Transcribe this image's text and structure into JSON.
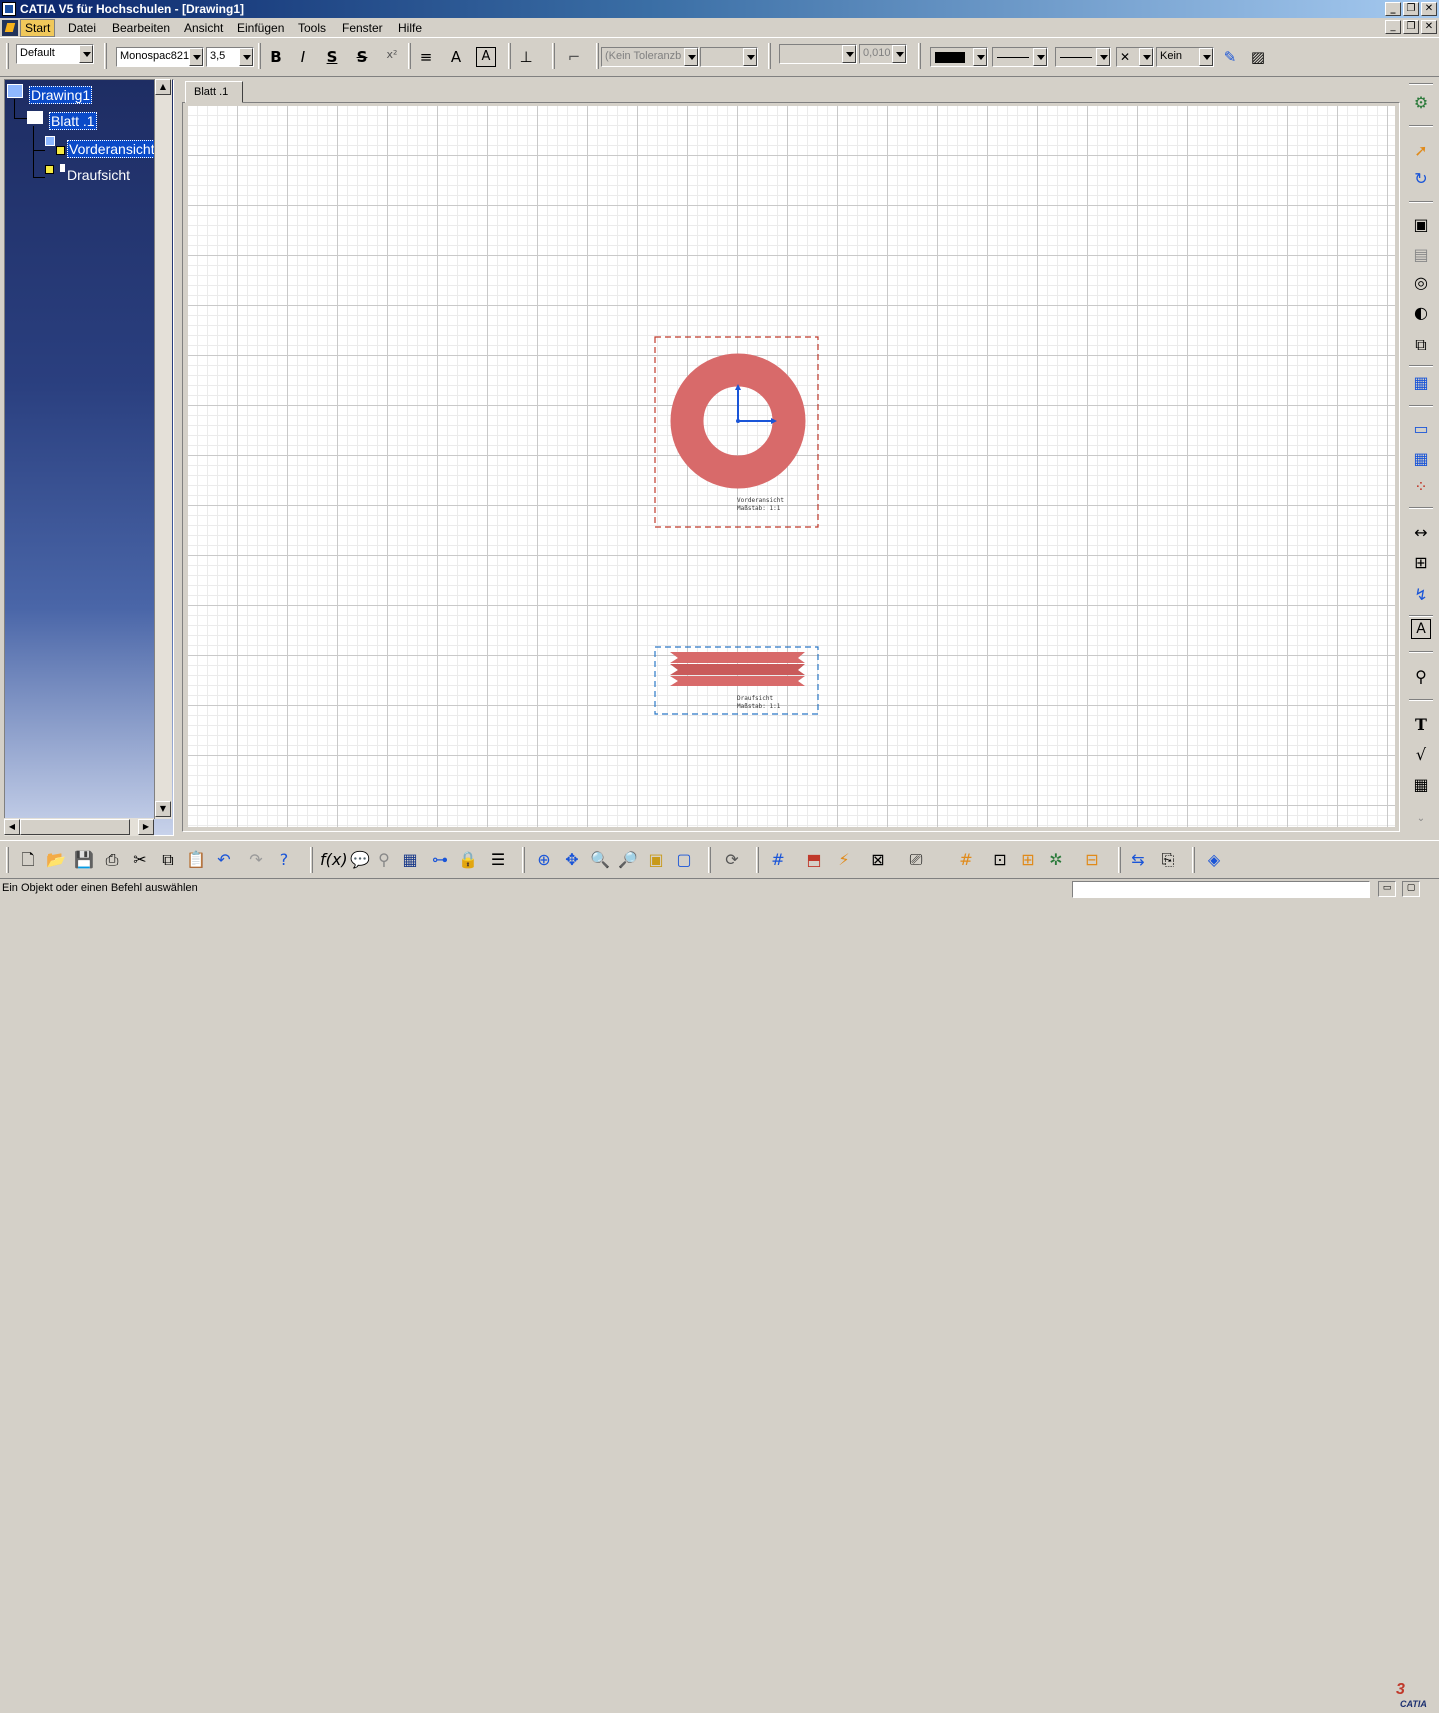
{
  "window": {
    "title": "CATIA V5 für Hochschulen - [Drawing1]",
    "title_buttons": [
      "_",
      "❐",
      "✕"
    ],
    "doc_buttons": [
      "_",
      "❐",
      "✕"
    ]
  },
  "menu": {
    "items": [
      "Start",
      "Datei",
      "Bearbeiten",
      "Ansicht",
      "Einfügen",
      "Tools",
      "Fenster",
      "Hilfe"
    ],
    "active": "Start"
  },
  "text_toolbar": {
    "style": "Default",
    "font": "Monospac821",
    "size": "3,5",
    "bold": "B",
    "italic": "I",
    "underline": "S",
    "strike": "S",
    "superscript": "x²",
    "tolerance": "(Kein Toleranzb",
    "tolerance_value": "0,010",
    "line_none": "Kein"
  },
  "tree": {
    "root": "Drawing1",
    "sheet": "Blatt .1",
    "views": [
      "Vorderansicht",
      "Draufsicht"
    ]
  },
  "sheet_tab": "Blatt .1",
  "views": {
    "front": {
      "name": "Vorderansicht",
      "scale_label": "Maßstab:  1:1",
      "frame_color": "#c0392b"
    },
    "top": {
      "name": "Draufsicht",
      "scale_label": "Maßstab:  1:1",
      "frame_color": "#2a78c8"
    }
  },
  "colors": {
    "part_fill": "#d86a6a",
    "axis_color": "#1a55d8",
    "title_gradient_start": "#0a246a",
    "selection": "#0a4ac8"
  },
  "status": {
    "message": "Ein Objekt oder einen Befehl auswählen",
    "command_input": ""
  },
  "brand": "CATIA"
}
